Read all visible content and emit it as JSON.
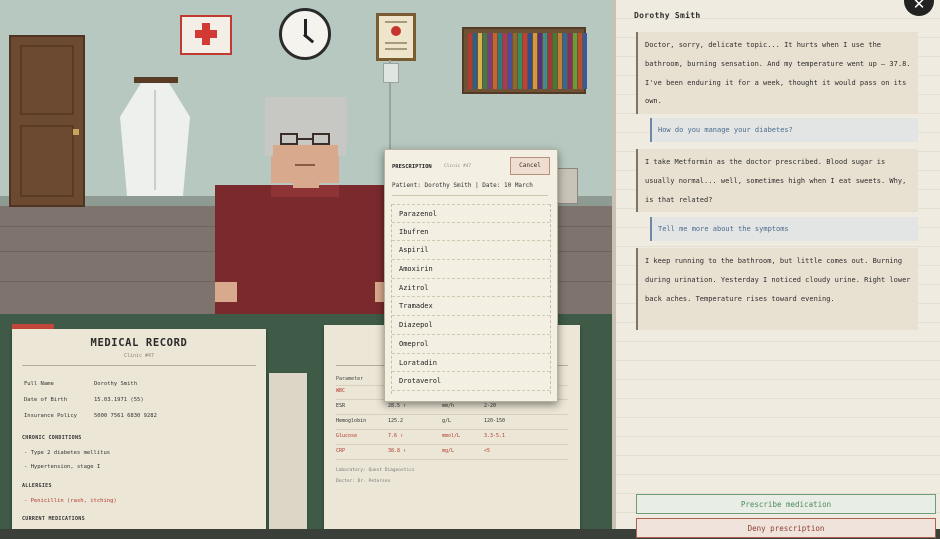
{
  "medical_record": {
    "title": "MEDICAL RECORD",
    "clinic": "Clinic #47",
    "fields": [
      {
        "label": "Full Name",
        "value": "Dorothy Smith"
      },
      {
        "label": "Date of Birth",
        "value": "15.03.1971 (55)"
      },
      {
        "label": "Insurance Policy",
        "value": "5000 7561 6830 9282"
      }
    ],
    "chronic_title": "CHRONIC CONDITIONS",
    "chronic": [
      "- Type 2 diabetes mellitus",
      "- Hypertension, stage I"
    ],
    "allergies_title": "ALLERGIES",
    "allergies": [
      "- Penicillin (rash, itching)"
    ],
    "meds_title": "CURRENT MEDICATIONS"
  },
  "lab_sheet": {
    "header": [
      "Parameter",
      "",
      "",
      ""
    ],
    "rows": [
      {
        "name": "WBC",
        "value": "",
        "unit": "",
        "ref": "",
        "flag": true
      },
      {
        "name": "ESR",
        "value": "28.5 ↑",
        "unit": "mm/h",
        "ref": "2-20",
        "flag": false
      },
      {
        "name": "Hemoglobin",
        "value": "125.2",
        "unit": "g/L",
        "ref": "120-150",
        "flag": false
      },
      {
        "name": "Glucose",
        "value": "7.6 ↑",
        "unit": "mmol/L",
        "ref": "3.3-5.1",
        "flag": true
      },
      {
        "name": "CRP",
        "value": "38.8 ↑",
        "unit": "mg/L",
        "ref": "<5",
        "flag": true
      }
    ],
    "footer_lab": "Laboratory: Quest Diagnostics",
    "footer_doctor": "Doctor: Dr. Peterson"
  },
  "prescription": {
    "title": "PRESCRIPTION",
    "clinic": "Clinic #47",
    "cancel_label": "Cancel",
    "patient_line": "Patient: Dorothy Smith  |  Date: 10 March",
    "medications": [
      "Parazenol",
      "Ibufren",
      "Aspiril",
      "Amoxirin",
      "Azitrol",
      "Tramadex",
      "Diazepol",
      "Omeprol",
      "Loratadin",
      "Drotaverol"
    ]
  },
  "chat": {
    "patient_name": "Dorothy Smith",
    "messages": [
      {
        "type": "patient",
        "text": "Doctor, sorry, delicate topic... It hurts when I use the bathroom, burning sensation. And my temperature went up — 37.8. I've been enduring it for a week, thought it would pass on its own."
      },
      {
        "type": "doctor",
        "text": "How do you manage your diabetes?"
      },
      {
        "type": "patient",
        "text": "I take Metformin as the doctor prescribed. Blood sugar is usually normal... well, sometimes high when I eat sweets. Why, is that related?"
      },
      {
        "type": "doctor",
        "text": "Tell me more about the symptoms"
      },
      {
        "type": "patient",
        "text": "I keep running to the bathroom, but little comes out. Burning during urination. Yesterday I noticed cloudy urine. Right lower back aches. Temperature rises toward evening."
      }
    ],
    "prescribe_label": "Prescribe medication",
    "second_action_label": "Deny prescription"
  },
  "close_label": "✕"
}
